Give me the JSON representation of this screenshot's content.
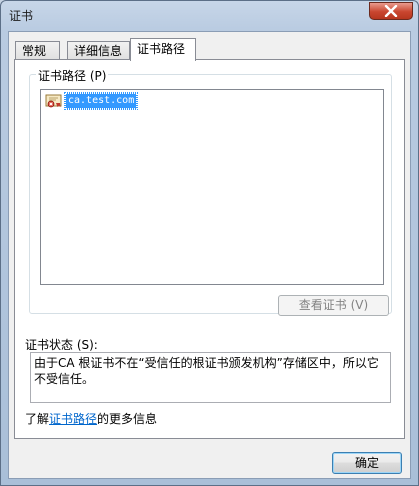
{
  "window": {
    "title": "证书"
  },
  "tabs": [
    {
      "label": "常规"
    },
    {
      "label": "详细信息"
    },
    {
      "label": "证书路径"
    }
  ],
  "cert_path": {
    "group_label": "证书路径 (P)",
    "items": [
      {
        "label": "ca.test.com",
        "icon": "certificate-error-icon"
      }
    ],
    "view_button_label": "查看证书 (V)"
  },
  "cert_status": {
    "label": "证书状态 (S):",
    "text": "由于CA 根证书不在“受信任的根证书颁发机构”存储区中，所以它不受信任。"
  },
  "learn_more": {
    "prefix": "了解",
    "link_text": "证书路径",
    "suffix": "的更多信息"
  },
  "buttons": {
    "ok_label": "确定"
  },
  "colors": {
    "selection": "#3399ff",
    "link": "#0066cc",
    "close_button": "#c9462f"
  }
}
